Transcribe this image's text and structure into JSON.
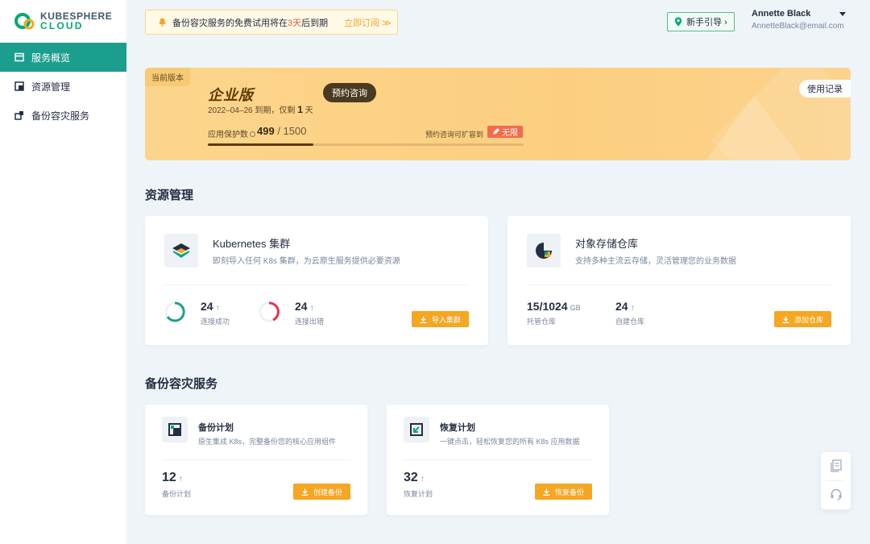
{
  "logo": {
    "line1": "KUBESPHERE",
    "line2": "CLOUD"
  },
  "sidebar": {
    "items": [
      {
        "label": "服务概览",
        "icon": "overview-icon",
        "active": true
      },
      {
        "label": "资源管理",
        "icon": "resource-icon",
        "active": false
      },
      {
        "label": "备份容灾服务",
        "icon": "backup-icon",
        "active": false
      }
    ]
  },
  "banner": {
    "prefix": "备份容灾服务的免费试用将在",
    "days": "3天",
    "suffix": "后到期",
    "link": "立即订阅 ≫"
  },
  "guide": {
    "label": "新手引导 ›"
  },
  "user": {
    "name": "Annette Black",
    "email": "AnnetteBlack@email.com"
  },
  "edition": {
    "tag": "当前版本",
    "title": "企业版",
    "expire_prefix": "2022–04–26 到期，仅剩",
    "expire_days": "1",
    "expire_suffix": "天",
    "consult": "预约咨询",
    "protect_label": "应用保护数",
    "protect_used": "499",
    "protect_total": " / 1500",
    "protect_fraction": 0.333,
    "extend_label": "预约咨询可扩容到",
    "unlimited": "无限",
    "history": "使用记录"
  },
  "resource": {
    "title": "资源管理",
    "k8s": {
      "title": "Kubernetes 集群",
      "desc": "即刻导入任何 K8s 集群，为云原生服务提供必要资源",
      "stat1_num": "24",
      "stat1_label": "连接成功",
      "stat2_num": "24",
      "stat2_label": "连接出错",
      "button": "导入集群"
    },
    "storage": {
      "title": "对象存储仓库",
      "desc": "支持多种主流云存储，灵活管理您的业务数据",
      "stat1_num": "15/1024",
      "stat1_unit": "GB",
      "stat1_label": "托管仓库",
      "stat2_num": "24",
      "stat2_label": "自建仓库",
      "button": "添加仓库"
    }
  },
  "backup": {
    "title": "备份容灾服务",
    "plan": {
      "title": "备份计划",
      "desc": "原生集成 K8s，完整备份您的核心应用组件",
      "num": "12",
      "label": "备份计划",
      "button": "创建备份"
    },
    "restore": {
      "title": "恢复计划",
      "desc": "一键点击，轻松恢复您的所有 K8s 应用数据",
      "num": "32",
      "label": "恢复计划",
      "button": "恢复备份"
    }
  },
  "arrow": "↑",
  "colors": {
    "accent": "#1c9e8e",
    "orange": "#f5a623",
    "green": "#00aa72",
    "red": "#e9334b"
  }
}
